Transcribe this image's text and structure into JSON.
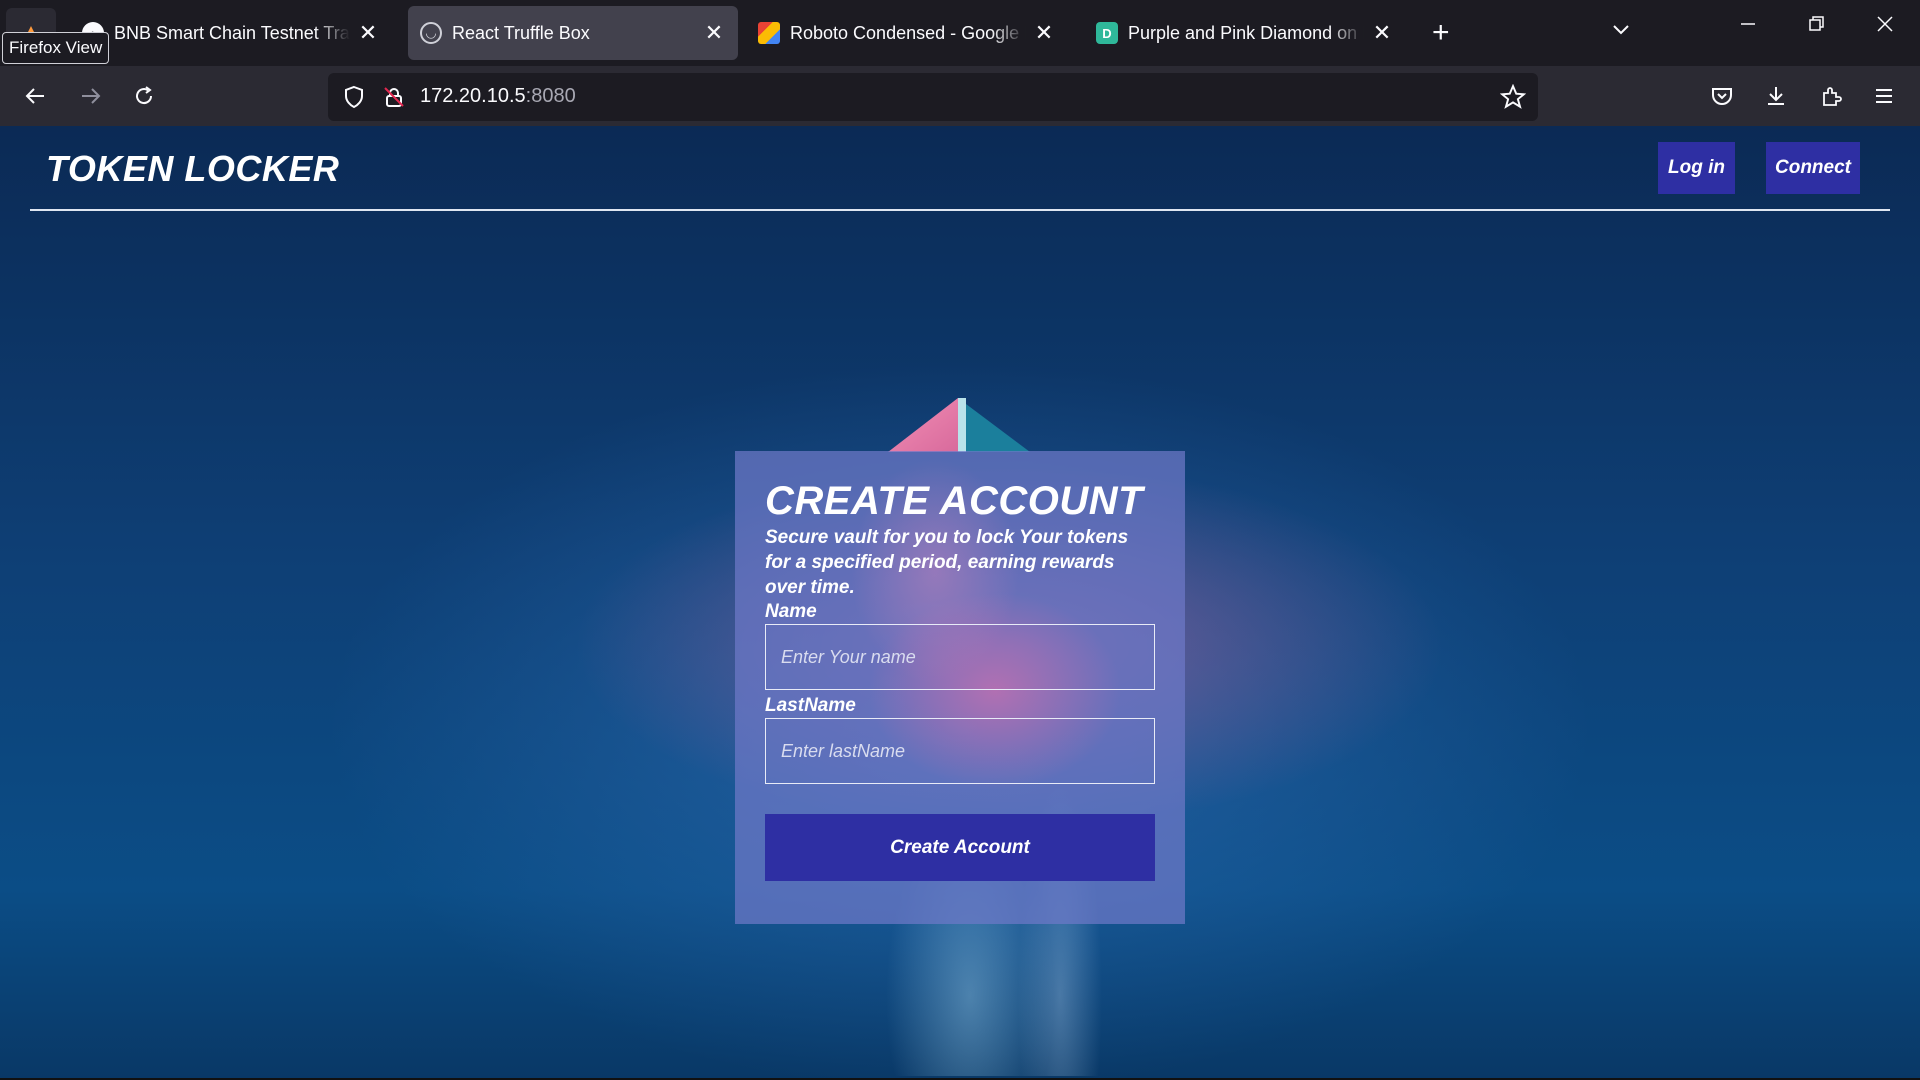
{
  "browser": {
    "firefox_view_tooltip": "Firefox View",
    "tabs": [
      {
        "title": "BNB Smart Chain Testnet Transa",
        "active": false
      },
      {
        "title": "React Truffle Box",
        "active": true
      },
      {
        "title": "Roboto Condensed - Google Fo",
        "active": false
      },
      {
        "title": "Purple and Pink Diamond on Bl",
        "active": false
      }
    ],
    "url_host": "172.20.10.5",
    "url_port": ":8080"
  },
  "header": {
    "brand": "TOKEN LOCKER",
    "login_label": "Log in",
    "connect_label": "Connect"
  },
  "form": {
    "title": "CREATE ACCOUNT",
    "subtitle": "Secure vault for you to lock Your tokens for a specified period, earning rewards over time.",
    "name_label": "Name",
    "name_placeholder": "Enter Your name",
    "lastname_label": "LastName",
    "lastname_placeholder": "Enter lastName",
    "submit_label": "Create Account"
  },
  "colors": {
    "button_bg": "#2e2fa3",
    "chrome_bg": "#1c1b22",
    "toolbar_bg": "#2b2a33"
  }
}
